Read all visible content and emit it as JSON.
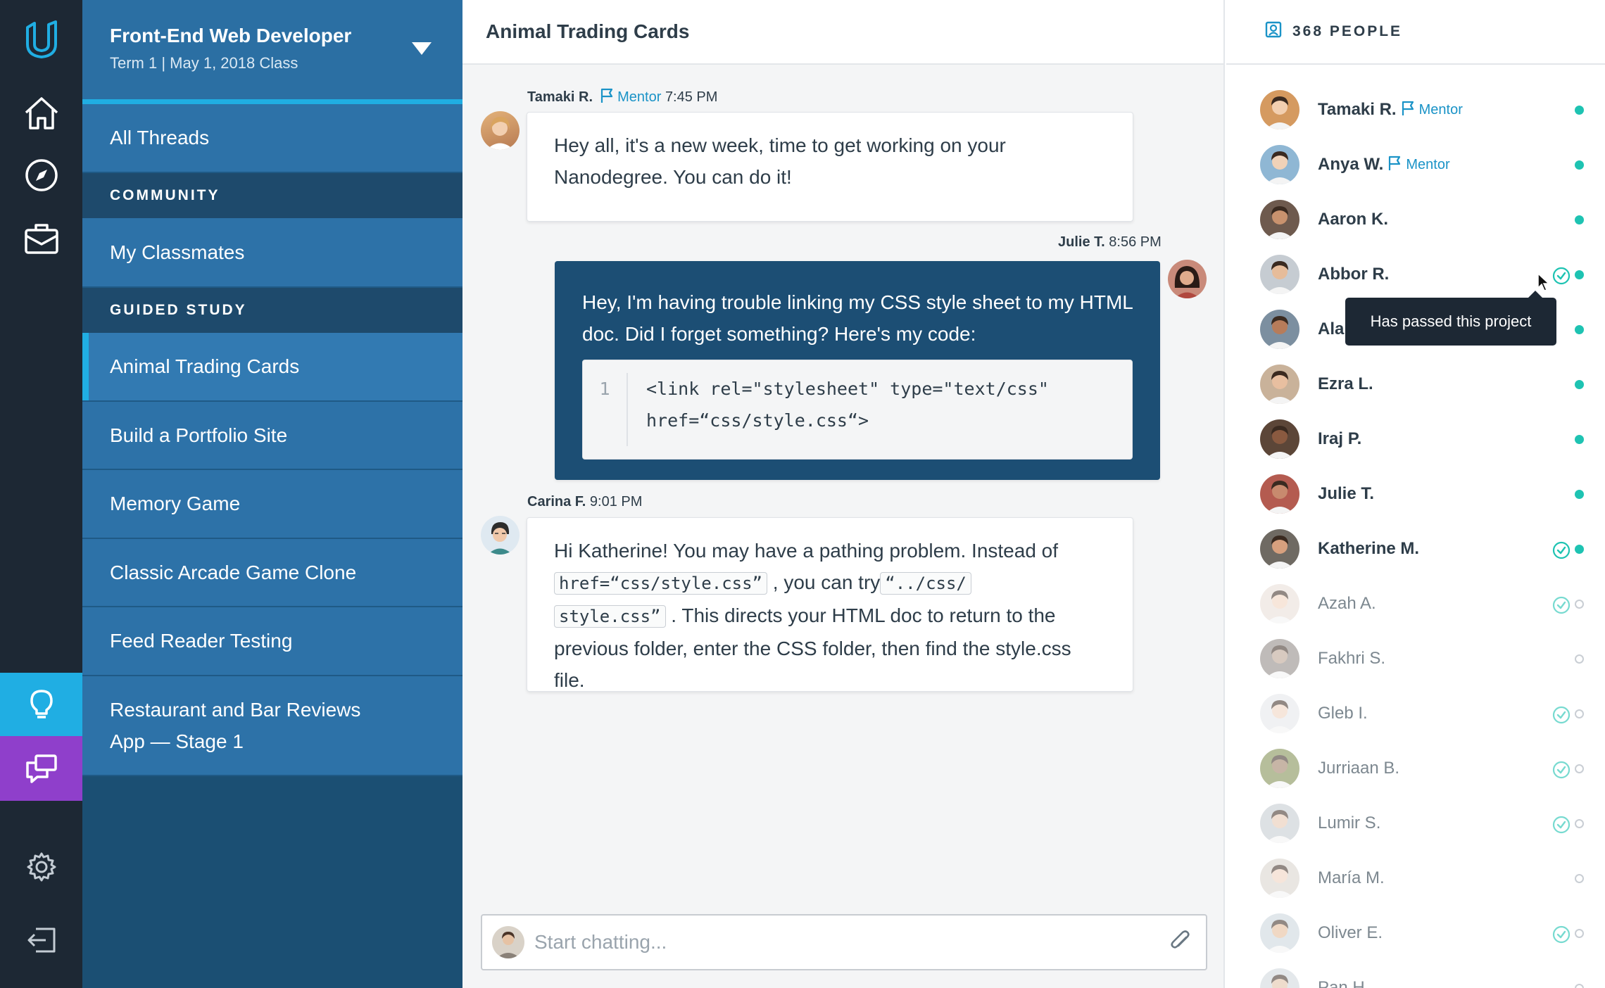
{
  "nav": {
    "icons": [
      "udacity-logo-icon",
      "home-icon",
      "compass-icon",
      "briefcase-icon",
      "lightbulb-icon",
      "chat-icon",
      "gear-icon",
      "logout-icon"
    ]
  },
  "program": {
    "title": "Front-End Web Developer",
    "subtitle": "Term 1 | May 1, 2018 Class",
    "all_threads": "All Threads",
    "community_header": "COMMUNITY",
    "classmates": "My Classmates",
    "guided_header": "GUIDED STUDY",
    "projects": [
      {
        "label": "Animal Trading Cards"
      },
      {
        "label": "Build a Portfolio Site"
      },
      {
        "label": "Memory Game"
      },
      {
        "label": "Classic Arcade Game Clone"
      },
      {
        "label": "Feed Reader Testing"
      },
      {
        "label": "Restaurant and Bar Reviews App — Stage 1"
      }
    ]
  },
  "chat": {
    "title": "Animal Trading Cards",
    "messages": [
      {
        "author": "Tamaki R.",
        "badge": "Mentor",
        "time": "7:45 PM",
        "text": "Hey all, it's a new week, time to get working on your Nanodegree. You can do it!"
      },
      {
        "author": "Julie T.",
        "time": "8:56 PM",
        "text": "Hey, I'm having trouble linking my CSS style sheet to my HTML doc. Did I forget something? Here's my code:",
        "code_line_no": "1",
        "code_1": "<link rel=\"stylesheet\" type=\"text/css\"",
        "code_2": "href=“css/style.css“>"
      },
      {
        "author": "Carina F.",
        "time": "9:01 PM",
        "t1": "Hi Katherine! You may have a pathing problem. Instead of",
        "c1": "href=“css/style.css”",
        "t2": ", you can try",
        "c2": "“../css/",
        "c3": "style.css”",
        "t3": ". This directs your HTML doc to return to the",
        "t4": "previous folder, enter the CSS folder, then find the style.css file."
      }
    ],
    "input_placeholder": "Start chatting..."
  },
  "people": {
    "count_label": "368 PEOPLE",
    "tooltip": "Has passed this project",
    "list": [
      {
        "name": "Tamaki R.",
        "badge": "Mentor",
        "online": true,
        "passed": false
      },
      {
        "name": "Anya W.",
        "badge": "Mentor",
        "online": true,
        "passed": false
      },
      {
        "name": "Aaron K.",
        "online": true,
        "passed": false
      },
      {
        "name": "Abbor R.",
        "online": true,
        "passed": true
      },
      {
        "name": "Alan",
        "online": true,
        "passed": false
      },
      {
        "name": "Ezra L.",
        "online": true,
        "passed": false
      },
      {
        "name": "Iraj P.",
        "online": true,
        "passed": false
      },
      {
        "name": "Julie T.",
        "online": true,
        "passed": false
      },
      {
        "name": "Katherine M.",
        "online": true,
        "passed": true
      },
      {
        "name": "Azah A.",
        "online": false,
        "passed": true
      },
      {
        "name": "Fakhri S.",
        "online": false,
        "passed": false
      },
      {
        "name": "Gleb I.",
        "online": false,
        "passed": true
      },
      {
        "name": "Jurriaan B.",
        "online": false,
        "passed": true
      },
      {
        "name": "Lumir S.",
        "online": false,
        "passed": true
      },
      {
        "name": "María M.",
        "online": false,
        "passed": false
      },
      {
        "name": "Oliver E.",
        "online": false,
        "passed": true
      },
      {
        "name": "Pan H.",
        "online": false,
        "passed": false
      }
    ]
  },
  "colors": {
    "accent": "#20aee3",
    "online": "#1ec3b2",
    "sidebar": "#1b4f73",
    "rail": "#1d2834",
    "purple": "#8f3fcb"
  }
}
